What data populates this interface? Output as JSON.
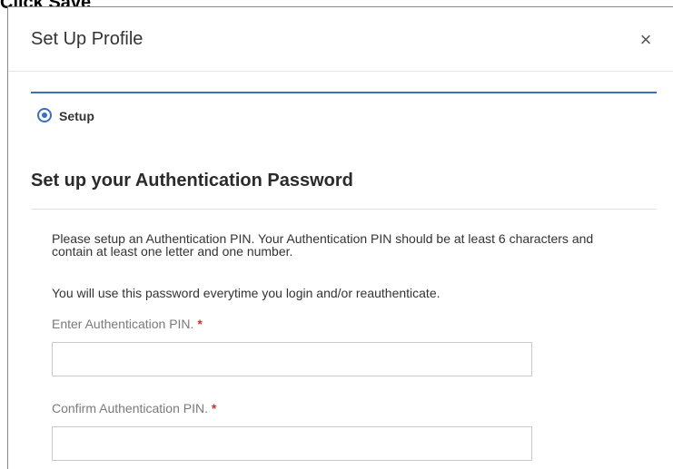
{
  "instruction": "Click Save",
  "modal": {
    "title": "Set Up Profile",
    "close_glyph": "×"
  },
  "stepper": {
    "step_label": "Setup",
    "active": true,
    "accent_color": "#3a6fc4"
  },
  "section": {
    "title": "Set up your Authentication Password",
    "description": "Please setup an Authentication PIN. Your Authentication PIN should be at least 6 characters and contain at least one letter and one number.",
    "note": "You will use this password everytime you login and/or reauthenticate."
  },
  "fields": {
    "pin": {
      "label": "Enter Authentication PIN.",
      "required_mark": "*",
      "value": "",
      "placeholder": ""
    },
    "confirm_pin": {
      "label": "Confirm Authentication PIN.",
      "required_mark": "*",
      "value": "",
      "placeholder": ""
    }
  },
  "icons": {
    "close": "close-icon",
    "step": "radio-selected-icon"
  }
}
